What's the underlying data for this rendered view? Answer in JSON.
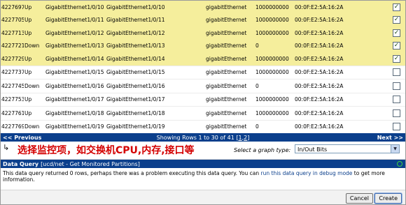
{
  "rows": [
    {
      "id": "4227697",
      "status": "Up",
      "name": "GigabitEthernet1/0/10",
      "desc": "GigabitEthernet1/0/10",
      "type": "gigabitEthernet",
      "speed": "1000000000",
      "mac": "00:0F:E2:5A:16:2A",
      "checked": true
    },
    {
      "id": "4227705",
      "status": "Up",
      "name": "GigabitEthernet1/0/11",
      "desc": "GigabitEthernet1/0/11",
      "type": "gigabitEthernet",
      "speed": "1000000000",
      "mac": "00:0F:E2:5A:16:2A",
      "checked": true
    },
    {
      "id": "4227713",
      "status": "Up",
      "name": "GigabitEthernet1/0/12",
      "desc": "GigabitEthernet1/0/12",
      "type": "gigabitEthernet",
      "speed": "1000000000",
      "mac": "00:0F:E2:5A:16:2A",
      "checked": true
    },
    {
      "id": "4227721",
      "status": "Down",
      "name": "GigabitEthernet1/0/13",
      "desc": "GigabitEthernet1/0/13",
      "type": "gigabitEthernet",
      "speed": "0",
      "mac": "00:0F:E2:5A:16:2A",
      "checked": true
    },
    {
      "id": "4227729",
      "status": "Up",
      "name": "GigabitEthernet1/0/14",
      "desc": "GigabitEthernet1/0/14",
      "type": "gigabitEthernet",
      "speed": "1000000000",
      "mac": "00:0F:E2:5A:16:2A",
      "checked": true
    },
    {
      "id": "4227737",
      "status": "Up",
      "name": "GigabitEthernet1/0/15",
      "desc": "GigabitEthernet1/0/15",
      "type": "gigabitEthernet",
      "speed": "1000000000",
      "mac": "00:0F:E2:5A:16:2A",
      "checked": false
    },
    {
      "id": "4227745",
      "status": "Down",
      "name": "GigabitEthernet1/0/16",
      "desc": "GigabitEthernet1/0/16",
      "type": "gigabitEthernet",
      "speed": "0",
      "mac": "00:0F:E2:5A:16:2A",
      "checked": false
    },
    {
      "id": "4227753",
      "status": "Up",
      "name": "GigabitEthernet1/0/17",
      "desc": "GigabitEthernet1/0/17",
      "type": "gigabitEthernet",
      "speed": "1000000000",
      "mac": "00:0F:E2:5A:16:2A",
      "checked": false
    },
    {
      "id": "4227761",
      "status": "Up",
      "name": "GigabitEthernet1/0/18",
      "desc": "GigabitEthernet1/0/18",
      "type": "gigabitEthernet",
      "speed": "1000000000",
      "mac": "00:0F:E2:5A:16:2A",
      "checked": false
    },
    {
      "id": "4227769",
      "status": "Down",
      "name": "GigabitEthernet1/0/19",
      "desc": "GigabitEthernet1/0/19",
      "type": "gigabitEthernet",
      "speed": "0",
      "mac": "00:0F:E2:5A:16:2A",
      "checked": false
    }
  ],
  "check_glyph": "✓",
  "nav": {
    "previous": "<< Previous",
    "showing_prefix": "Showing Rows 1 to 30 of 41 [",
    "page1": "1",
    "sep": ",",
    "page2": "2",
    "showing_suffix": "]",
    "next": "Next >>"
  },
  "graph": {
    "corner_arrow": "↳",
    "annotation": "选择监控项，如交换机CPU,内存,接口等",
    "label": "Select a graph type:",
    "selected": "In/Out Bits",
    "dropdown_arrow": "▼"
  },
  "data_query": {
    "title": "Data Query",
    "subtitle": "[ucd/net - Get Monitored Partitions]",
    "message_before": "This data query returned 0 rows, perhaps there was a problem executing this data query. You can ",
    "link": "run this data query in debug mode",
    "message_after": " to get more information."
  },
  "buttons": {
    "cancel": "Cancel",
    "create": "Create"
  },
  "colors": {
    "selected_row": "#f5ee9c",
    "header_blue": "#0b3f8c",
    "annotation_red": "#d40000"
  }
}
